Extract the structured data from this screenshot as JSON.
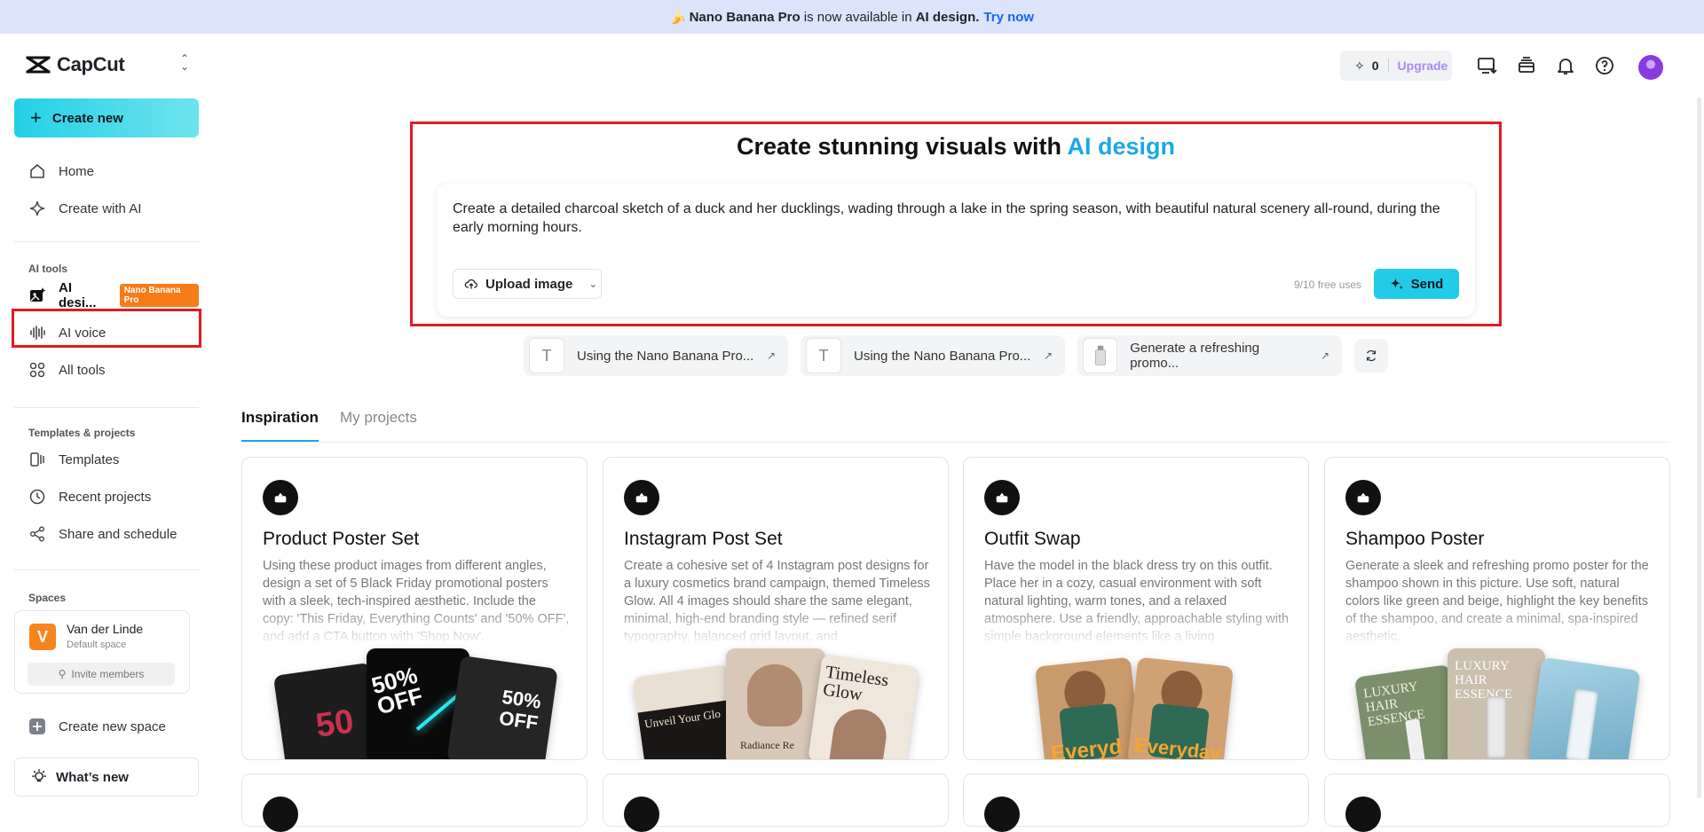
{
  "banner": {
    "product": "Nano Banana Pro",
    "middle": "is now available in",
    "feature": "AI design.",
    "cta": "Try now"
  },
  "sidebar": {
    "brand": "CapCut",
    "create_new": "Create new",
    "nav": [
      {
        "label": "Home",
        "icon": "home-icon"
      },
      {
        "label": "Create with AI",
        "icon": "sparkle-icon"
      }
    ],
    "ai_tools_label": "AI tools",
    "ai_tools": [
      {
        "label": "AI desi...",
        "badge": "Nano Banana Pro",
        "icon": "image-ai-icon"
      },
      {
        "label": "AI voice",
        "icon": "waveform-icon"
      },
      {
        "label": "All tools",
        "icon": "grid-icon"
      }
    ],
    "templates_label": "Templates & projects",
    "templates": [
      {
        "label": "Templates",
        "icon": "template-icon"
      },
      {
        "label": "Recent projects",
        "icon": "clock-icon"
      },
      {
        "label": "Share and schedule",
        "icon": "share-icon"
      }
    ],
    "spaces_label": "Spaces",
    "space": {
      "initial": "V",
      "name": "Van der Linde",
      "subtitle": "Default space",
      "invite": "Invite members"
    },
    "create_space": "Create new space",
    "whats_new": "What’s new"
  },
  "topbar": {
    "credits": "0",
    "upgrade": "Upgrade"
  },
  "hero": {
    "title_prefix": "Create stunning visuals with",
    "title_accent": "AI design",
    "prompt": "Create a detailed charcoal sketch of a duck and her ducklings, wading through a lake in the spring season, with beautiful natural scenery all-round, during the early morning hours.",
    "upload": "Upload image",
    "free_uses": "9/10 free uses",
    "send": "Send"
  },
  "suggestions": [
    {
      "label": "Using the Nano Banana Pro..."
    },
    {
      "label": "Using the Nano Banana Pro..."
    },
    {
      "label": "Generate a refreshing promo..."
    }
  ],
  "tabs": [
    "Inspiration",
    "My projects"
  ],
  "cards": [
    {
      "title": "Product Poster Set",
      "desc": "Using these product images from different angles, design a set of 5 Black Friday promotional posters with a sleek, tech-inspired aesthetic. Include the copy: 'This Friday, Everything Counts' and '50% OFF', and add a CTA button with 'Shop Now'.",
      "art": [
        "50",
        "50% OFF",
        "50% OFF"
      ]
    },
    {
      "title": "Instagram Post Set",
      "desc": "Create a cohesive set of 4 Instagram post designs for a luxury cosmetics brand campaign, themed Timeless Glow. All 4 images should share the same elegant, minimal, high-end branding style — refined serif typography, balanced grid layout, and",
      "art": [
        "Unveil Your Glo",
        "Radiance Re",
        "Timeless Glow"
      ]
    },
    {
      "title": "Outfit Swap",
      "desc": "Have the model in the black dress try on this outfit. Place her in a cozy, casual environment with soft natural lighting, warm tones, and a relaxed atmosphere. Use a friendly, approachable styling with simple background elements like a living",
      "art": [
        "Everyd",
        "Everyday"
      ]
    },
    {
      "title": "Shampoo Poster",
      "desc": "Generate a sleek and refreshing promo poster for the shampoo shown in this picture. Use soft, natural colors like green and beige, highlight the key benefits of the shampoo, and create a minimal, spa-inspired aesthetic.",
      "art": [
        "LUXURY HAIR ESSENCE",
        "LUXURY HAIR ESSENCE"
      ]
    }
  ],
  "colors": {
    "accent": "#1aa8e8",
    "create_btn": "#23d0e6",
    "badge": "#f77b16",
    "highlight": "#e01b24"
  }
}
